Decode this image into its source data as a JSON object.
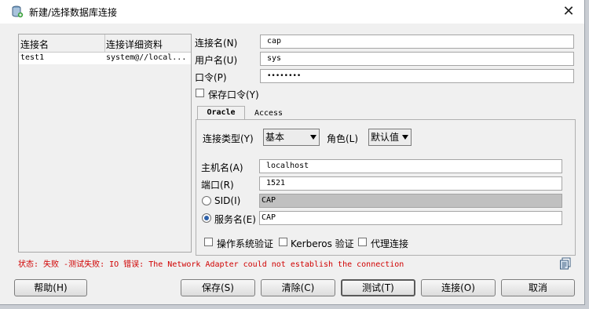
{
  "window": {
    "title": "新建/选择数据库连接",
    "close_glyph": "✕"
  },
  "connections": {
    "headers": [
      "连接名",
      "连接详细资料"
    ],
    "rows": [
      {
        "name": "test1",
        "details": "system@//local..."
      }
    ]
  },
  "form": {
    "conn_name_label": "连接名(N)",
    "conn_name_value": "cap",
    "user_label": "用户名(U)",
    "user_value": "sys",
    "password_label": "口令(P)",
    "password_value": "••••••••",
    "save_password_label": "保存口令(Y)"
  },
  "tabs": {
    "oracle": "Oracle",
    "access": "Access"
  },
  "oracle": {
    "conn_type_label": "连接类型(Y)",
    "conn_type_value": "基本",
    "role_label": "角色(L)",
    "role_value": "默认值",
    "host_label": "主机名(A)",
    "host_value": "localhost",
    "port_label": "端口(R)",
    "port_value": "1521",
    "sid_label": "SID(I)",
    "sid_value": "CAP",
    "service_label": "服务名(E)",
    "service_value": "CAP",
    "os_auth_label": "操作系统验证",
    "kerberos_label": "Kerberos 验证",
    "proxy_label": "代理连接"
  },
  "status": {
    "text": "状态: 失败 -测试失败: IO 错误: The Network Adapter could not establish the connection",
    "color": "#d00000"
  },
  "buttons": {
    "help": "帮助(H)",
    "save": "保存(S)",
    "clear": "清除(C)",
    "test": "测试(T)",
    "connect": "连接(O)",
    "cancel": "取消"
  }
}
